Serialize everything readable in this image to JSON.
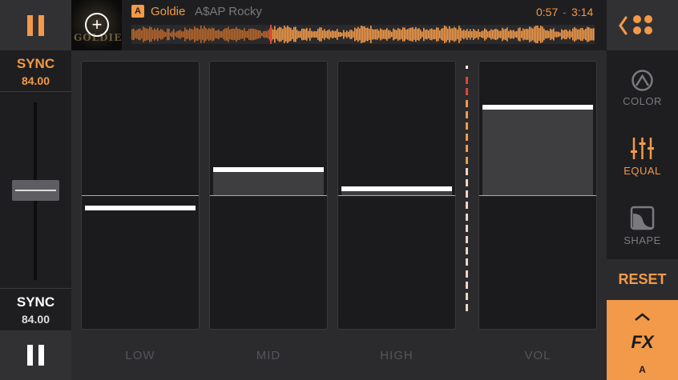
{
  "left_deck": {
    "top_pause_icon": "pause-icon",
    "top_sync_label": "SYNC",
    "top_bpm": "84.00",
    "bottom_sync_label": "SYNC",
    "bottom_bpm": "84.00",
    "bottom_pause_icon": "pause-icon"
  },
  "track": {
    "deck": "A",
    "title": "Goldie",
    "artist": "A$AP Rocky",
    "cover_text": "GOLDIE",
    "add_icon": "plus-circle-icon",
    "elapsed": "0:57",
    "separator": "-",
    "total": "3:14",
    "progress": 0.3
  },
  "eq": {
    "bands": [
      {
        "label": "LOW",
        "level": -0.1
      },
      {
        "label": "MID",
        "level": 0.2
      },
      {
        "label": "HIGH",
        "level": 0.05
      },
      {
        "label": "VOL",
        "level": 0.69
      }
    ]
  },
  "sidebar": {
    "nav_icons": [
      "chevron-left-icon",
      "grid-dots-icon"
    ],
    "items": [
      {
        "label": "COLOR",
        "icon": "color-filter-icon",
        "active": false
      },
      {
        "label": "EQUAL",
        "icon": "equalizer-sliders-icon",
        "active": true
      },
      {
        "label": "SHAPE",
        "icon": "shape-icon",
        "active": false
      }
    ],
    "reset_label": "RESET",
    "fx_label": "FX",
    "fx_deck": "A",
    "fx_up_icon": "chevron-up-icon"
  },
  "colors": {
    "accent": "#f29a4a",
    "background": "#2b2b2d",
    "panel": "#1e1e20",
    "meter_red": "#e0453a",
    "meter_pale": "#f4d6c4"
  }
}
